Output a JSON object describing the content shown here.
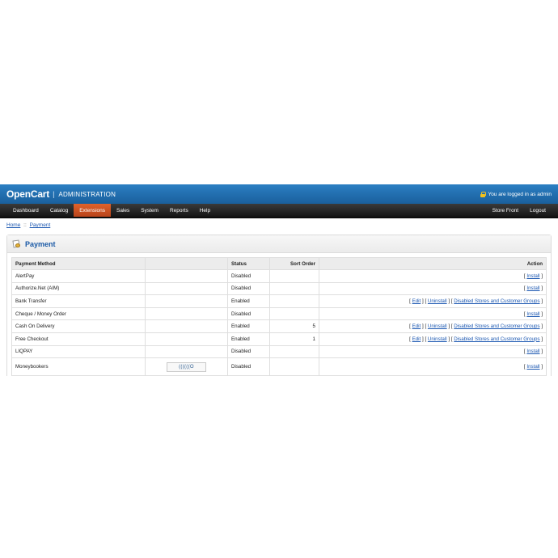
{
  "header": {
    "logo": "OpenCart",
    "separator": "|",
    "subtitle": "ADMINISTRATION",
    "login_text": "You are logged in as admin"
  },
  "nav": {
    "left": [
      "Dashboard",
      "Catalog",
      "Extensions",
      "Sales",
      "System",
      "Reports",
      "Help"
    ],
    "active": "Extensions",
    "right": [
      "Store Front",
      "Logout"
    ]
  },
  "breadcrumb": {
    "home": "Home",
    "separator": "::",
    "current": "Payment"
  },
  "box": {
    "title": "Payment"
  },
  "table": {
    "headers": {
      "method": "Payment Method",
      "logo": "",
      "status": "Status",
      "sort": "Sort Order",
      "action": "Action"
    },
    "rows": [
      {
        "method": "AlertPay",
        "logo": "",
        "status": "Disabled",
        "sort": "",
        "actions": [
          "Install"
        ]
      },
      {
        "method": "Authorize.Net (AIM)",
        "logo": "",
        "status": "Disabled",
        "sort": "",
        "actions": [
          "Install"
        ]
      },
      {
        "method": "Bank Transfer",
        "logo": "",
        "status": "Enabled",
        "sort": "",
        "actions": [
          "Edit",
          "Uninstall",
          "Disabled Stores and Customer Groups"
        ]
      },
      {
        "method": "Cheque / Money Order",
        "logo": "",
        "status": "Disabled",
        "sort": "",
        "actions": [
          "Install"
        ]
      },
      {
        "method": "Cash On Delivery",
        "logo": "",
        "status": "Enabled",
        "sort": "5",
        "actions": [
          "Edit",
          "Uninstall",
          "Disabled Stores and Customer Groups"
        ]
      },
      {
        "method": "Free Checkout",
        "logo": "",
        "status": "Enabled",
        "sort": "1",
        "actions": [
          "Edit",
          "Uninstall",
          "Disabled Stores and Customer Groups"
        ]
      },
      {
        "method": "LIQPAY",
        "logo": "",
        "status": "Disabled",
        "sort": "",
        "actions": [
          "Install"
        ]
      },
      {
        "method": "Moneybookers",
        "logo": "((((((O",
        "status": "Disabled",
        "sort": "",
        "actions": [
          "Install"
        ]
      }
    ]
  },
  "colors": {
    "header_blue": "#1f6aac",
    "nav_dark": "#222222",
    "nav_active": "#d4542a",
    "link": "#1b57b1",
    "title": "#1b5aa6"
  },
  "icons": {
    "lock": "lock-icon",
    "payment": "payment-icon"
  }
}
